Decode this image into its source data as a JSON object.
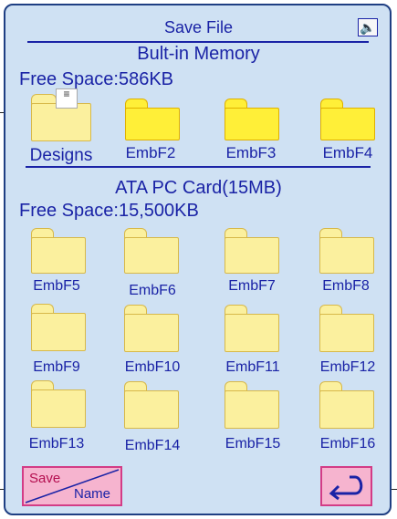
{
  "header": {
    "title": "Save File",
    "sound_icon": "speaker-icon"
  },
  "built_in": {
    "title": "Bult-in Memory",
    "free_space": "Free Space:586KB"
  },
  "built_in_folders": [
    {
      "name": "Designs",
      "style": "open-folder"
    },
    {
      "name": "EmbF2",
      "style": "bright"
    },
    {
      "name": "EmbF3",
      "style": "bright"
    },
    {
      "name": "EmbF4",
      "style": "bright"
    }
  ],
  "card": {
    "title": "ATA PC Card(15MB)",
    "free_space": "Free Space:15,500KB"
  },
  "card_folders": [
    "EmbF5",
    "EmbF6",
    "EmbF7",
    "EmbF8",
    "EmbF9",
    "EmbF10",
    "EmbF11",
    "EmbF12",
    "EmbF13",
    "EmbF14",
    "EmbF15",
    "EmbF16"
  ],
  "buttons": {
    "save_label": "Save",
    "name_label": "Name",
    "back_icon": "return-arrow-icon"
  },
  "colors": {
    "text": "#1a23a6",
    "border": "#1f3f83",
    "panel": "#cfe1f3",
    "button": "#f6b4cf"
  }
}
